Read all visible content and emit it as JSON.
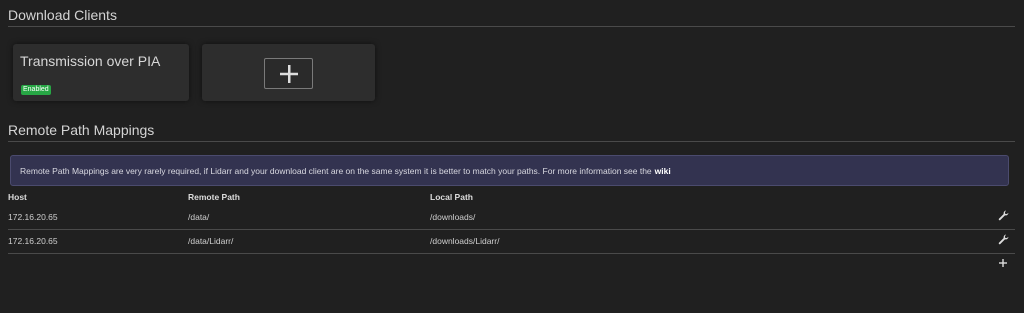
{
  "download_clients": {
    "title": "Download Clients",
    "clients": [
      {
        "name": "Transmission over PIA",
        "status": "Enabled"
      }
    ],
    "add_icon": "plus-icon"
  },
  "remote_path_mappings": {
    "title": "Remote Path Mappings",
    "info_text": "Remote Path Mappings are very rarely required, if Lidarr and your download client are on the same system it is better to match your paths. For more information see the",
    "info_link": "wiki",
    "columns": [
      "Host",
      "Remote Path",
      "Local Path"
    ],
    "rows": [
      {
        "host": "172.16.20.65",
        "remote_path": "/data/",
        "local_path": "/downloads/"
      },
      {
        "host": "172.16.20.65",
        "remote_path": "/data/Lidarr/",
        "local_path": "/downloads/Lidarr/"
      }
    ],
    "row_action_icon": "wrench-icon",
    "add_icon": "plus-icon"
  },
  "colors": {
    "background": "#202020",
    "card": "#2d2d2d",
    "enabled_badge": "#27a745",
    "info_box": "#333350"
  }
}
